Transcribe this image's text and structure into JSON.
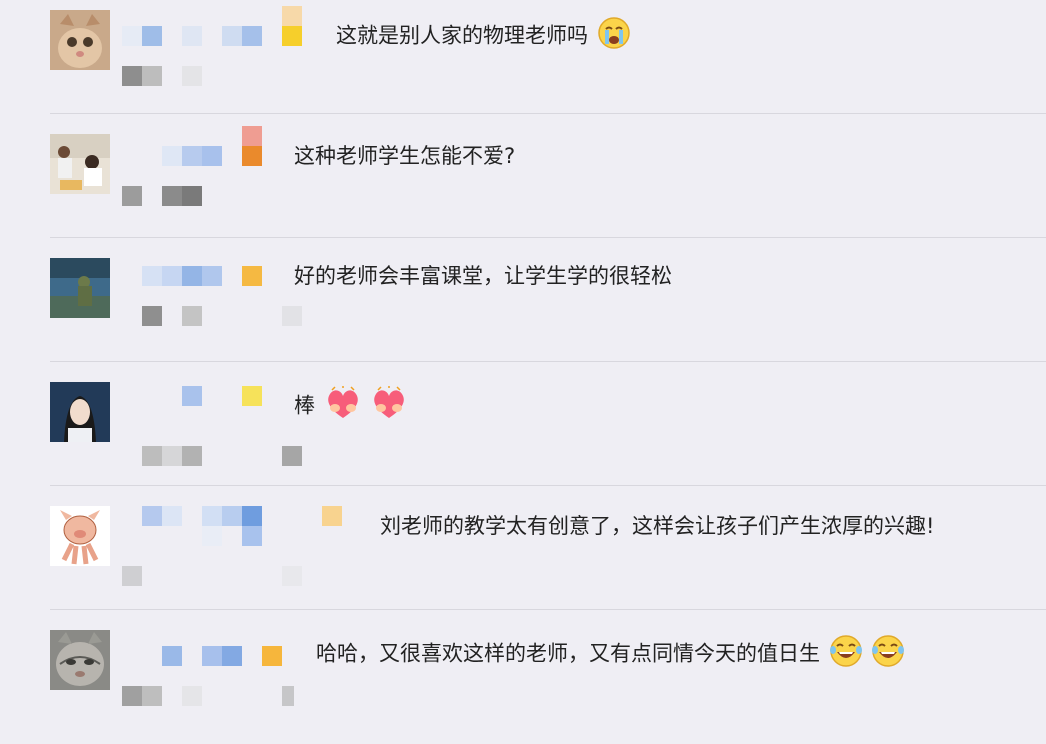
{
  "comments": [
    {
      "text": "这就是别人家的物理老师吗",
      "emojis": [
        "crying-emoji"
      ],
      "avatar": "cat-avatar"
    },
    {
      "text": "这种老师学生怎能不爱?",
      "emojis": [],
      "avatar": "photo-avatar"
    },
    {
      "text": "好的老师会丰富课堂，让学生学的很轻松",
      "emojis": [],
      "avatar": "statue-avatar"
    },
    {
      "text": "棒",
      "emojis": [
        "heart-emoji",
        "heart-emoji"
      ],
      "avatar": "woman-avatar"
    },
    {
      "text": "刘老师的教学太有创意了，这样会让孩子们产生浓厚的兴趣!",
      "emojis": [],
      "avatar": "cartoon-pig-avatar"
    },
    {
      "text": "哈哈，又很喜欢这样的老师，又有点同情今天的值日生",
      "emojis": [
        "laughing-emoji",
        "laughing-emoji"
      ],
      "avatar": "grey-cat-avatar"
    }
  ]
}
